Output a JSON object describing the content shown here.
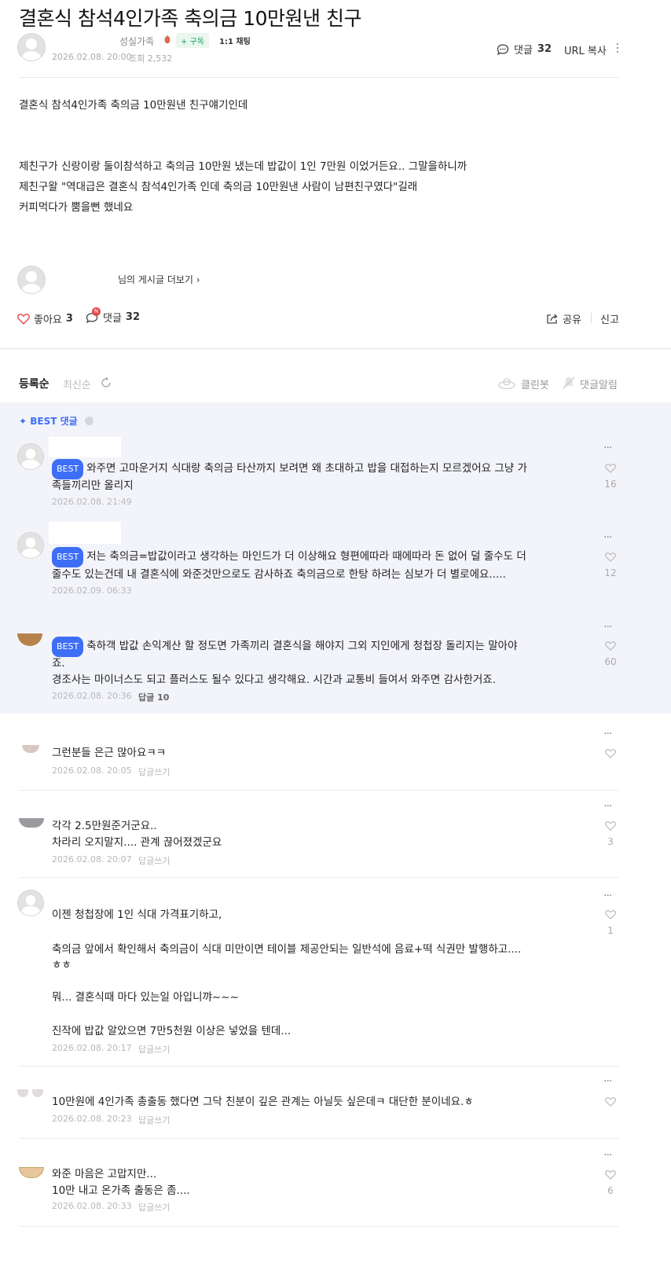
{
  "post": {
    "title": "결혼식 참석4인가족 축의금 10만원낸 친구",
    "author": "성실가족",
    "subscribe_label": "+ 구독",
    "chat_label": "1:1 채팅",
    "date": "2026.02.08. 20:00",
    "views": "조회 2,532",
    "comment_label": "댓글",
    "comment_count": "32",
    "url_copy_label": "URL 복사",
    "body": [
      "결혼식 참석4인가족 축의금 10만원낸  친구얘기인데",
      "제친구가 신랑이랑 둘이참석하고 축의금 10만원 냈는데 밥값이  1인 7만원 이었거든요..  그말을하니까",
      "제친구왈 \"역대급은 결혼식 참석4인가족 인데 축의금 10만원낸  사람이 남편친구였다\"길래",
      "커피먹다가 뿜을뻔 했네요"
    ],
    "more_posts_label": "님의 게시글 더보기 ›",
    "like_label": "좋아요",
    "like_count": "3",
    "reply_badge": "N",
    "share_label": "공유",
    "report_label": "신고"
  },
  "comments_header": {
    "sort_registered": "등록순",
    "sort_latest": "최신순",
    "cleanbot_label": "클린봇",
    "notify_label": "댓글알림",
    "best_title": "✦ BEST 댓글"
  },
  "best_comments": [
    {
      "badge": "BEST",
      "lines": [
        "와주면 고마운거지 식대랑 축의금 타산까지 보려면 왜 초대하고 밥을 대접하는지 모르겠어요 그냥 가",
        "족들끼리만 올리지"
      ],
      "date": "2026.02.08. 21:49",
      "reply": "",
      "likes": "16"
    },
    {
      "badge": "BEST",
      "lines": [
        "저는 축의금=밥값이라고 생각하는 마인드가 더 이상해요 형편에따라 때에따라 돈 없어 덜 줄수도 더",
        "줄수도 있는건데 내 결혼식에 와준것만으로도 감사하죠 축의금으로 한탕 하려는 심보가 더 별로에요....."
      ],
      "date": "2026.02.09. 06:33",
      "reply": "",
      "likes": "12"
    },
    {
      "badge": "BEST",
      "lines": [
        "축하객 밥값 손익계산 할 정도면 가족끼리 결혼식을 해야지 그외 지인에게 청첩장 돌리지는 말아야",
        "죠.",
        "경조사는 마이너스도 되고 플러스도 될수 있다고 생각해요. 시간과 교통비 들여서 와주면 감사한거죠."
      ],
      "date": "2026.02.08. 20:36",
      "reply": "답글 10",
      "likes": "60"
    }
  ],
  "comments": [
    {
      "lines": [
        "그런분들 은근 많아요ㅋㅋ"
      ],
      "date": "2026.02.08. 20:05",
      "reply": "답글쓰기",
      "likes": ""
    },
    {
      "lines": [
        "각각 2.5만원준거군요..",
        "차라리 오지말지.... 관계 끊어졌겠군요"
      ],
      "date": "2026.02.08. 20:07",
      "reply": "답글쓰기",
      "likes": "3"
    },
    {
      "lines": [
        "이젠 청첩장에 1인 식대 가격표기하고,",
        "",
        "축의금 앞에서 확인해서 축의금이 식대 미만이면 테이블 제공안되는 일반석에 음료+떡 식권만 발행하고....",
        "ㅎㅎ",
        "",
        "뭐... 결혼식때 마다 있는일 아입니꺄~~~",
        "",
        "진작에 밥값 알았으면 7만5천원 이상은 넣었을 텐데..."
      ],
      "date": "2026.02.08. 20:17",
      "reply": "답글쓰기",
      "likes": "1"
    },
    {
      "lines": [
        "10만원에 4인가족 총출동 했다면 그닥 친분이 깊은 관계는 아닐듯 싶은데ㅋ 대단한 분이네요.ㅎ"
      ],
      "date": "2026.02.08. 20:23",
      "reply": "답글쓰기",
      "likes": ""
    },
    {
      "lines": [
        "와준 마음은 고맙지만...",
        "10만 내고 온가족 출동은 좀...."
      ],
      "date": "2026.02.08. 20:33",
      "reply": "답글쓰기",
      "likes": "6"
    }
  ],
  "colors": {
    "accent": "#3d6ef5",
    "subscribe": "#17a15d",
    "heart": "#e5484d"
  }
}
